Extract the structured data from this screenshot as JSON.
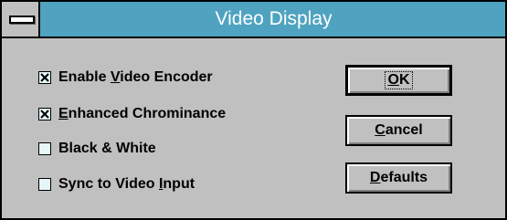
{
  "window": {
    "title": "Video Display"
  },
  "checkboxes": [
    {
      "pre": "Enable ",
      "accel": "V",
      "post": "ideo Encoder",
      "checked": true
    },
    {
      "pre": "",
      "accel": "E",
      "post": "nhanced Chrominance",
      "checked": true
    },
    {
      "pre": "Black & White",
      "accel": "",
      "post": "",
      "checked": false
    },
    {
      "pre": "Sync to Video ",
      "accel": "I",
      "post": "nput",
      "checked": false
    }
  ],
  "buttons": {
    "ok": {
      "pre": "",
      "accel": "O",
      "post": "K"
    },
    "cancel": {
      "pre": "",
      "accel": "C",
      "post": "ancel"
    },
    "defaults": {
      "pre": "",
      "accel": "D",
      "post": "efaults"
    }
  },
  "colors": {
    "titlebar": "#4fa3c0",
    "face": "#c0c0c0",
    "checkbox_fill": "#e6f6f8"
  }
}
